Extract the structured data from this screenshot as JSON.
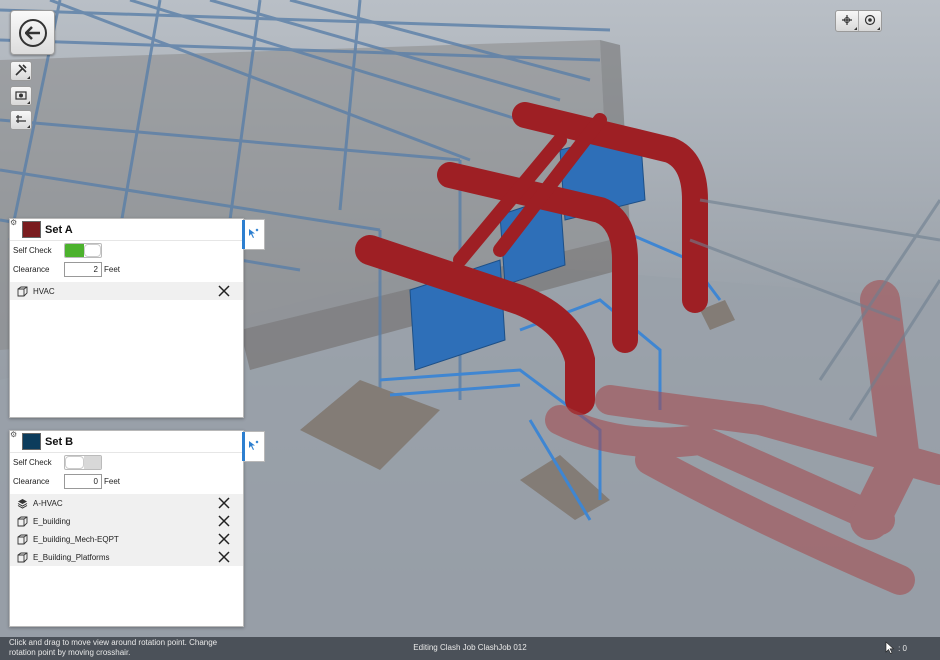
{
  "toolbar": {
    "back": "back",
    "tools": [
      "tools-icon",
      "camera-settings-icon",
      "section-icon"
    ],
    "nav": [
      "crosshair-icon",
      "view-icon"
    ]
  },
  "set_a": {
    "title": "Set A",
    "color": "#7a1c1f",
    "self_check_label": "Self Check",
    "self_check": true,
    "clearance_label": "Clearance",
    "clearance_value": "2",
    "clearance_unit": "Feet",
    "items": [
      {
        "name": "HVAC",
        "icon": "cube-icon"
      }
    ]
  },
  "set_b": {
    "title": "Set B",
    "color": "#0c3c5c",
    "self_check_label": "Self Check",
    "self_check": false,
    "clearance_label": "Clearance",
    "clearance_value": "0",
    "clearance_unit": "Feet",
    "items": [
      {
        "name": "A-HVAC",
        "icon": "layers-icon"
      },
      {
        "name": "E_building",
        "icon": "cube-icon"
      },
      {
        "name": "E_building_Mech-EQPT",
        "icon": "cube-icon"
      },
      {
        "name": "E_Building_Platforms",
        "icon": "cube-icon"
      }
    ]
  },
  "status": {
    "hint": "Click and drag to move view around rotation point. Change rotation point by moving crosshair.",
    "center": "Editing Clash Job ClashJob 012",
    "count": ": 0"
  }
}
